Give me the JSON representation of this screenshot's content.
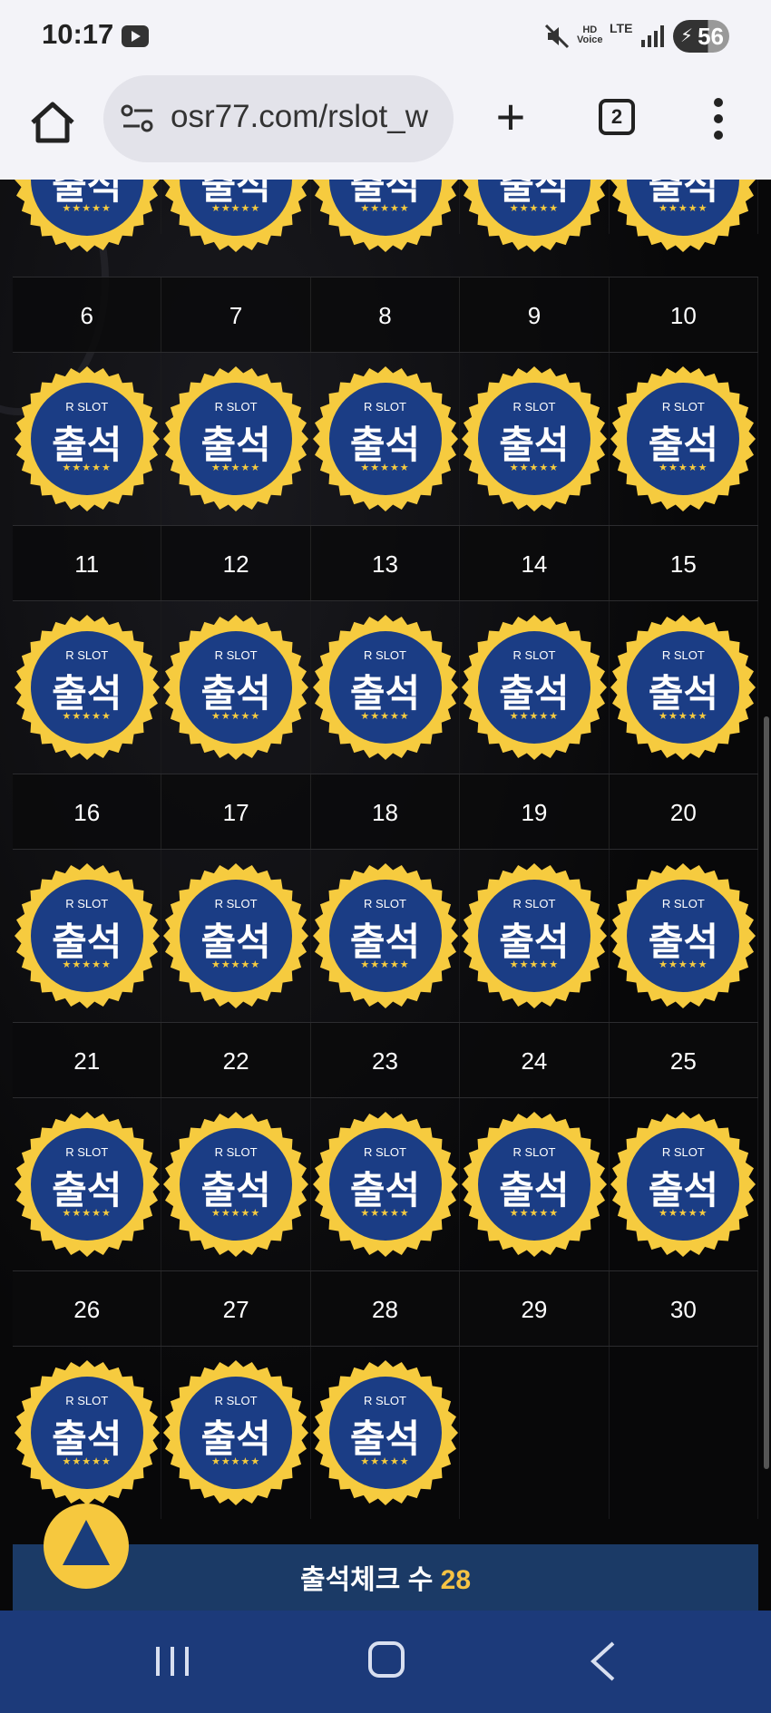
{
  "status_bar": {
    "time": "10:17",
    "battery": "56",
    "hd_voice": "HD\nVoice",
    "lte": "LTE"
  },
  "browser": {
    "url": "osr77.com/rslot_w",
    "tab_count": "2"
  },
  "badge": {
    "brand": "R SLOT",
    "label": "출석",
    "stars": "★★★★★"
  },
  "calendar": {
    "rows": [
      {
        "days": [
          "6",
          "7",
          "8",
          "9",
          "10"
        ],
        "attended": [
          true,
          true,
          true,
          true,
          true
        ]
      },
      {
        "days": [
          "11",
          "12",
          "13",
          "14",
          "15"
        ],
        "attended": [
          true,
          true,
          true,
          true,
          true
        ]
      },
      {
        "days": [
          "16",
          "17",
          "18",
          "19",
          "20"
        ],
        "attended": [
          true,
          true,
          true,
          true,
          true
        ]
      },
      {
        "days": [
          "21",
          "22",
          "23",
          "24",
          "25"
        ],
        "attended": [
          true,
          true,
          true,
          true,
          true
        ]
      },
      {
        "days": [
          "26",
          "27",
          "28",
          "29",
          "30"
        ],
        "attended": [
          true,
          true,
          true,
          false,
          false
        ]
      }
    ]
  },
  "summary": {
    "label": "출석체크 수 ",
    "count": "28"
  },
  "colors": {
    "badge_blue": "#1b3d85",
    "badge_gold": "#f6cb3f",
    "nav_blue": "#1c3a7a"
  }
}
